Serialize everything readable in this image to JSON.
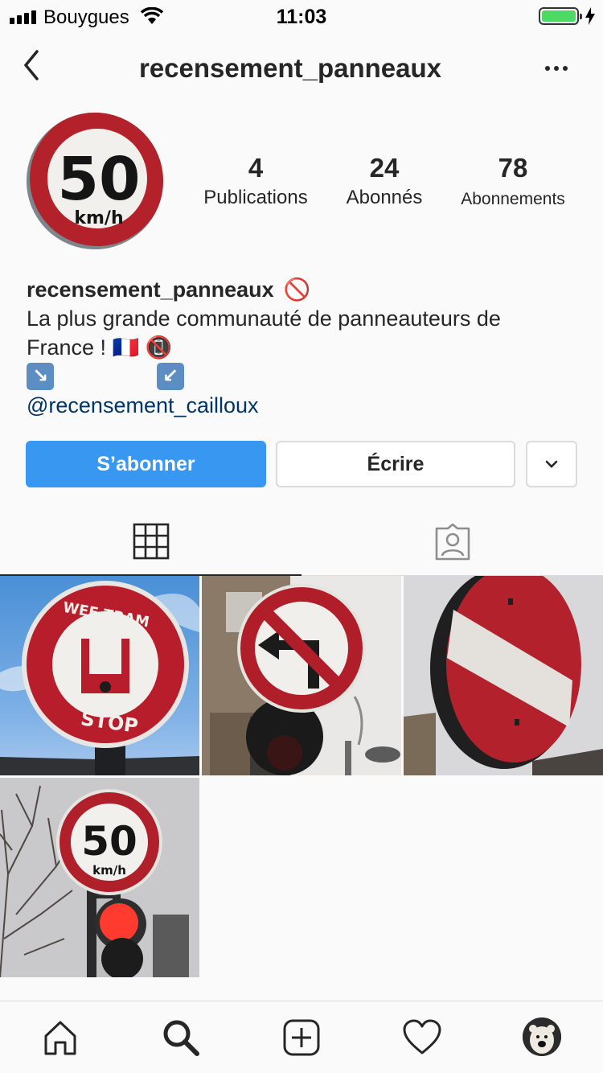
{
  "status_bar": {
    "carrier": "Bouygues",
    "time": "11:03",
    "battery_level": 1.0
  },
  "header": {
    "username": "recensement_panneaux"
  },
  "profile": {
    "stats": [
      {
        "value": "4",
        "label": "Publications"
      },
      {
        "value": "24",
        "label": "Abonnés"
      },
      {
        "value": "78",
        "label": "Abonnements"
      }
    ],
    "display_name": "recensement_panneaux",
    "name_emoji": "🚫",
    "bio_line1": "La plus grande communauté de panneauteurs de",
    "bio_line2": "France !",
    "bio_emoji_flag": "🇫🇷",
    "bio_emoji_nophone": "📵",
    "arrow_right": "↘",
    "arrow_left": "↙",
    "mention": "@recensement_cailloux"
  },
  "actions": {
    "follow_label": "S’abonner",
    "message_label": "Écrire"
  },
  "colors": {
    "accent": "#3897f0",
    "mention": "#003569",
    "border": "#dbdbdb",
    "text": "#262626"
  },
  "posts": {
    "p1_sign_top": "WEE TRAM",
    "p1_sign_bottom": "STOP",
    "p4_speed": "50",
    "p4_unit": "km/h"
  },
  "avatar_sign": {
    "speed": "50",
    "unit": "km/h"
  },
  "icons": {
    "tabs": [
      "grid-icon",
      "tagged-icon"
    ],
    "bottom": [
      "home-icon",
      "search-icon",
      "add-post-icon",
      "heart-icon",
      "profile-avatar"
    ]
  }
}
